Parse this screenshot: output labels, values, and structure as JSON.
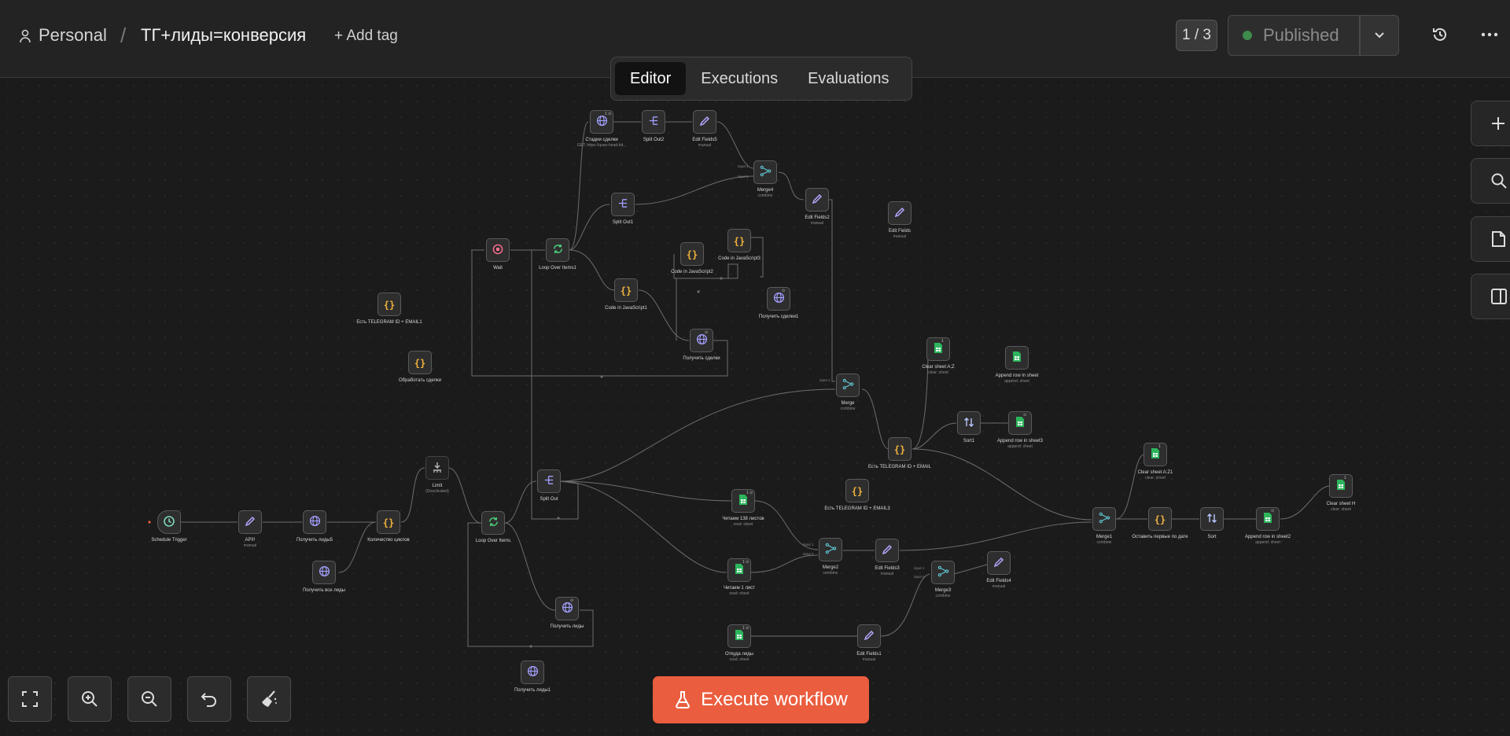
{
  "header": {
    "project": "Personal",
    "separator": "/",
    "workflow_name": "ТГ+лиды=конверсия",
    "add_tag": "+ Add tag",
    "version": "1 / 3",
    "published": "Published"
  },
  "tabs": [
    {
      "label": "Editor",
      "active": true
    },
    {
      "label": "Executions",
      "active": false
    },
    {
      "label": "Evaluations",
      "active": false
    }
  ],
  "execute_button": "Execute workflow",
  "colors": {
    "accent": "#ea5d3e",
    "published_dot": "#3f8a4c",
    "node_globe": "#a3a0ff",
    "node_code": "#f2b33d",
    "node_sheet": "#2db55d"
  },
  "nodes": [
    {
      "id": "schedule",
      "label": "Schedule Trigger",
      "sub": "",
      "icon": "clock"
    },
    {
      "id": "api",
      "label": "API!!",
      "sub": "manual",
      "icon": "pencil"
    },
    {
      "id": "leads5",
      "label": "Получить лиды5",
      "sub": "",
      "icon": "globe"
    },
    {
      "id": "allleads",
      "label": "Получить все лиды",
      "sub": "",
      "icon": "globe"
    },
    {
      "id": "cycles",
      "label": "Количество циклов",
      "sub": "",
      "icon": "code"
    },
    {
      "id": "limit",
      "label": "Limit",
      "sub": "(Deactivated)",
      "icon": "limit"
    },
    {
      "id": "loop",
      "label": "Loop Over Items",
      "sub": "",
      "icon": "loop"
    },
    {
      "id": "splitout",
      "label": "Split Out",
      "sub": "",
      "icon": "split"
    },
    {
      "id": "getleads",
      "label": "Получить лиды",
      "sub": "",
      "icon": "globe"
    },
    {
      "id": "getleads1",
      "label": "Получить лиды1",
      "sub": "",
      "icon": "globe"
    },
    {
      "id": "wait",
      "label": "Wait",
      "sub": "",
      "icon": "wait"
    },
    {
      "id": "loop1",
      "label": "Loop Over Items1",
      "sub": "",
      "icon": "loop"
    },
    {
      "id": "stages",
      "label": "Стадии сделки",
      "sub": "GET: https://quan-head-bit...",
      "icon": "globe"
    },
    {
      "id": "splitout2",
      "label": "Split Out2",
      "sub": "",
      "icon": "split"
    },
    {
      "id": "editfields5",
      "label": "Edit Fields5",
      "sub": "manual",
      "icon": "pencil"
    },
    {
      "id": "splitout1",
      "label": "Split Out1",
      "sub": "",
      "icon": "split"
    },
    {
      "id": "merge4",
      "label": "Merge4",
      "sub": "combine",
      "icon": "merge"
    },
    {
      "id": "editfields2",
      "label": "Edit Fields2",
      "sub": "manual",
      "icon": "pencil"
    },
    {
      "id": "editfields",
      "label": "Edit Fields",
      "sub": "manual",
      "icon": "pencil"
    },
    {
      "id": "codejs2",
      "label": "Code in JavaScript2",
      "sub": "",
      "icon": "code"
    },
    {
      "id": "codejs3",
      "label": "Code in JavaScript3",
      "sub": "",
      "icon": "code"
    },
    {
      "id": "codejs1",
      "label": "Code in JavaScript1",
      "sub": "",
      "icon": "code"
    },
    {
      "id": "getdeals",
      "label": "Получить сделки",
      "sub": "",
      "icon": "globe"
    },
    {
      "id": "getdeals1",
      "label": "Получить сделки1",
      "sub": "",
      "icon": "globe"
    },
    {
      "id": "tgemail1",
      "label": "Есть TELEGRAM ID + EMAIL1",
      "sub": "",
      "icon": "code"
    },
    {
      "id": "processdeals",
      "label": "Обработать сделки",
      "sub": "",
      "icon": "code"
    },
    {
      "id": "merge",
      "label": "Merge",
      "sub": "combine",
      "icon": "merge"
    },
    {
      "id": "clearaz",
      "label": "Clear sheet A:Z",
      "sub": "clear: sheet",
      "icon": "sheet"
    },
    {
      "id": "appendrow",
      "label": "Append row in sheet",
      "sub": "append: sheet",
      "icon": "sheet"
    },
    {
      "id": "sort1",
      "label": "Sort1",
      "sub": "",
      "icon": "sort"
    },
    {
      "id": "appendrow3",
      "label": "Append row in sheet3",
      "sub": "append: sheet",
      "icon": "sheet"
    },
    {
      "id": "tgemail",
      "label": "Есть TELEGRAM ID + EMAIL",
      "sub": "",
      "icon": "code"
    },
    {
      "id": "tgemail3",
      "label": "Есть TELEGRAM ID + EMAIL3",
      "sub": "",
      "icon": "code"
    },
    {
      "id": "read138",
      "label": "Читаем 138 листов",
      "sub": "read: sheet",
      "icon": "sheet"
    },
    {
      "id": "read1",
      "label": "Читаем 1 лист",
      "sub": "read: sheet",
      "icon": "sheet"
    },
    {
      "id": "whereleads",
      "label": "Откуда лиды",
      "sub": "read: sheet",
      "icon": "sheet"
    },
    {
      "id": "merge2",
      "label": "Merge2",
      "sub": "combine",
      "icon": "merge"
    },
    {
      "id": "editfields3",
      "label": "Edit Fields3",
      "sub": "manual",
      "icon": "pencil"
    },
    {
      "id": "merge3",
      "label": "Merge3",
      "sub": "combine",
      "icon": "merge"
    },
    {
      "id": "editfields4",
      "label": "Edit Fields4",
      "sub": "manual",
      "icon": "pencil"
    },
    {
      "id": "editfields1",
      "label": "Edit Fields1",
      "sub": "manual",
      "icon": "pencil"
    },
    {
      "id": "merge1",
      "label": "Merge1",
      "sub": "combine",
      "icon": "merge"
    },
    {
      "id": "keepfirst",
      "label": "Оставить первые по дате",
      "sub": "",
      "icon": "code"
    },
    {
      "id": "sort",
      "label": "Sort",
      "sub": "",
      "icon": "sort"
    },
    {
      "id": "appendrow2",
      "label": "Append row in sheet2",
      "sub": "append: sheet",
      "icon": "sheet"
    },
    {
      "id": "clearaz1",
      "label": "Clear sheet A:Z1",
      "sub": "clear: sheet",
      "icon": "sheet"
    },
    {
      "id": "clearh",
      "label": "Clear sheet H",
      "sub": "clear: sheet",
      "icon": "sheet"
    }
  ],
  "badges": [
    {
      "node": "stages",
      "text": "1 ⊙"
    },
    {
      "node": "getdeals",
      "text": "⊙"
    },
    {
      "node": "getdeals1",
      "text": "⊙"
    },
    {
      "node": "clearaz",
      "text": "1"
    },
    {
      "node": "appendrow3",
      "text": "⊙"
    },
    {
      "node": "clearaz1",
      "text": "1"
    },
    {
      "node": "clearh",
      "text": "1"
    },
    {
      "node": "appendrow2",
      "text": "⊙"
    },
    {
      "node": "read138",
      "text": "1 ⊙"
    },
    {
      "node": "read1",
      "text": "1 ⊙"
    },
    {
      "node": "whereleads",
      "text": "1 ⊙"
    },
    {
      "node": "getleads",
      "text": "⊙"
    }
  ]
}
